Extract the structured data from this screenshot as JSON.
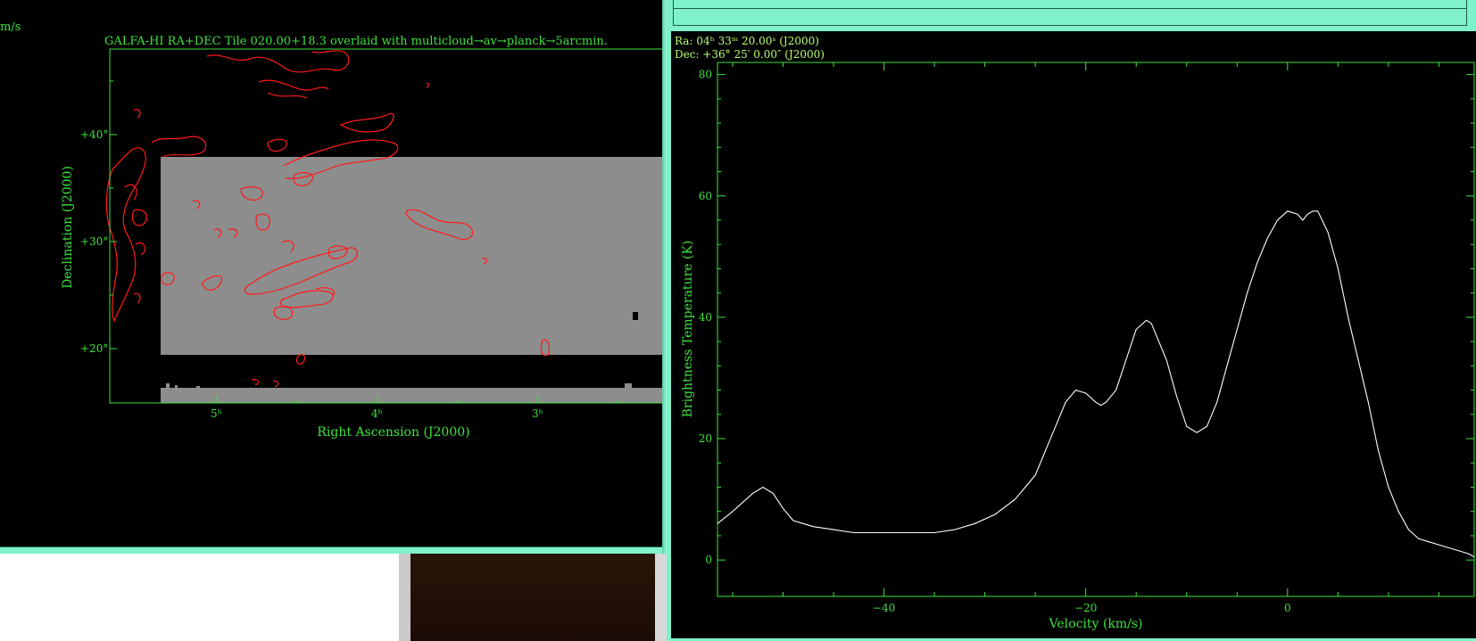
{
  "left_window": {
    "corner_unit_fragment": "m/s",
    "map_title": "GALFA-HI RA+DEC Tile 020.00+18.3 overlaid with multicloud→av→planck→5arcmin.",
    "y_axis_label": "Declination (J2000)",
    "x_axis_label": "Right Ascension (J2000)",
    "dec_ticks": [
      "+40°",
      "+30°",
      "+20°"
    ],
    "ra_ticks": [
      "5ʰ",
      "4ʰ",
      "3ʰ"
    ],
    "colors": {
      "frame": "#3ee23e",
      "contour": "#ff1a1a",
      "data_tile": "#8d8d8d"
    }
  },
  "right_window": {
    "coord_ra": "Ra: 04ʰ 33ᵐ 20.00ˢ (J2000)",
    "coord_dec": "Dec: +36° 25′ 0.00″ (J2000)"
  },
  "chart_data": {
    "type": "line",
    "title": "",
    "xlabel": "Velocity (km/s)",
    "ylabel": "Brightness Temperature (K)",
    "xlim": [
      -56.5,
      18.5
    ],
    "ylim": [
      -6,
      82
    ],
    "x_ticks": [
      -40,
      -20,
      0
    ],
    "y_ticks": [
      0,
      20,
      40,
      60,
      80
    ],
    "x_tick_labels": [
      "−40",
      "−20",
      "0"
    ],
    "y_tick_labels": [
      "0",
      "20",
      "40",
      "60",
      "80"
    ],
    "series": [
      {
        "color": "#ffffff",
        "x": [
          -56.5,
          -55,
          -53,
          -52,
          -51,
          -50,
          -49,
          -48,
          -47,
          -45,
          -43,
          -41,
          -39,
          -37,
          -35,
          -33,
          -31,
          -29,
          -27,
          -25,
          -24,
          -23,
          -22,
          -21,
          -20,
          -19,
          -18.5,
          -18,
          -17,
          -16,
          -15,
          -14,
          -13.5,
          -13,
          -12,
          -11,
          -10,
          -9,
          -8,
          -7,
          -6,
          -5,
          -4,
          -3,
          -2,
          -1,
          0,
          1,
          1.5,
          2,
          2.5,
          3,
          4,
          5,
          6,
          7,
          8,
          9,
          10,
          11,
          12,
          13,
          14,
          15,
          16,
          17,
          18,
          18.5
        ],
        "y": [
          6,
          8,
          11,
          12,
          11,
          8.5,
          6.5,
          6,
          5.5,
          5,
          4.5,
          4.5,
          4.5,
          4.5,
          4.5,
          5,
          6,
          7.5,
          10,
          14,
          18,
          22,
          26,
          28,
          27.5,
          26,
          25.5,
          26,
          28,
          33,
          38,
          39.5,
          39,
          37,
          33,
          27,
          22,
          21,
          22,
          26,
          32,
          38,
          44,
          49,
          53,
          56,
          57.5,
          57,
          56,
          57,
          57.5,
          57.5,
          54,
          48,
          40,
          33,
          26,
          18,
          12,
          8,
          5,
          3.5,
          3,
          2.5,
          2,
          1.5,
          1,
          0.5
        ]
      }
    ]
  }
}
